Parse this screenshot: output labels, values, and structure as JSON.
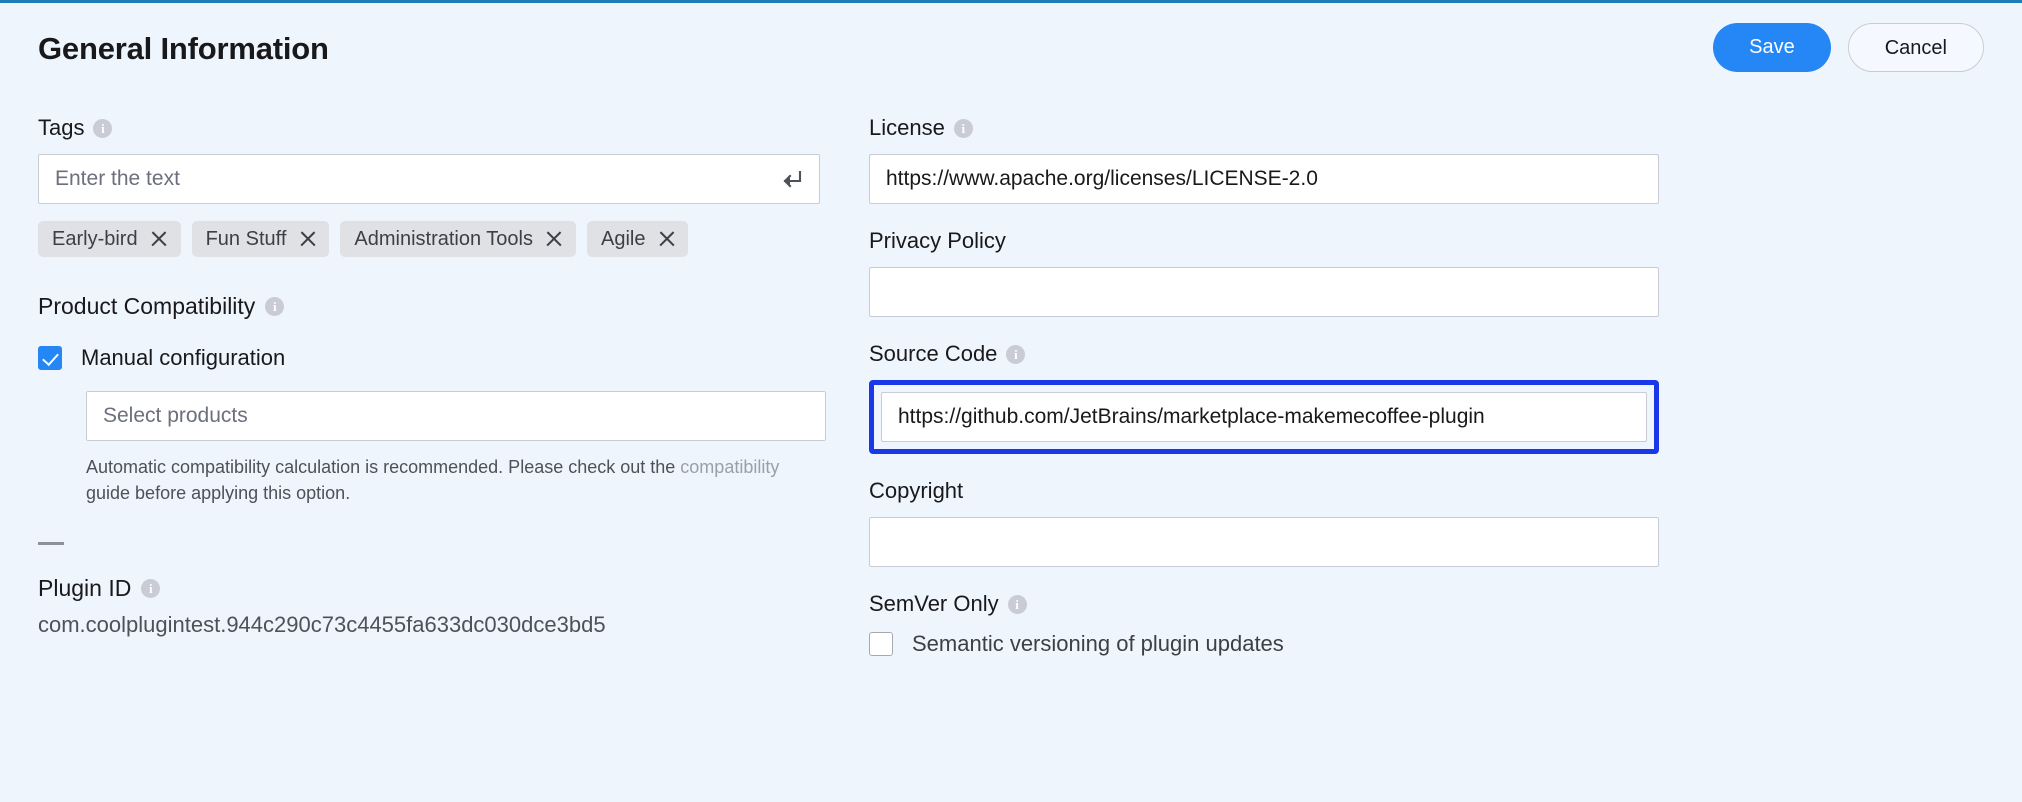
{
  "theme": {
    "background": "#eff5fd",
    "accent": "#2587f5",
    "top_rule": "#1a7fb8",
    "focus_ring": "#1a37e8",
    "chip_bg": "#dfe1e5"
  },
  "header": {
    "title": "General Information",
    "save_label": "Save",
    "cancel_label": "Cancel"
  },
  "left": {
    "tags": {
      "label": "Tags",
      "info_icon": "info-icon",
      "placeholder": "Enter the text",
      "value": "",
      "enter_icon": "enter-return-icon",
      "chips": [
        {
          "label": "Early-bird",
          "remove_icon": "close-icon"
        },
        {
          "label": "Fun Stuff",
          "remove_icon": "close-icon"
        },
        {
          "label": "Administration Tools",
          "remove_icon": "close-icon"
        },
        {
          "label": "Agile",
          "remove_icon": "close-icon"
        }
      ]
    },
    "product_compatibility": {
      "label": "Product Compatibility",
      "info_icon": "info-icon",
      "manual_checkbox": {
        "label": "Manual configuration",
        "checked": true
      },
      "select_products": {
        "placeholder": "Select products",
        "value": ""
      },
      "helper_prefix": "Automatic compatibility calculation is recommended. Please check out the ",
      "helper_link": "compatibility",
      "helper_suffix": " guide before applying this option."
    },
    "plugin_id": {
      "label": "Plugin ID",
      "info_icon": "info-icon",
      "value": "com.coolplugintest.944c290c73c4455fa633dc030dce3bd5"
    }
  },
  "right": {
    "license": {
      "label": "License",
      "info_icon": "info-icon",
      "value": "https://www.apache.org/licenses/LICENSE-2.0",
      "placeholder": ""
    },
    "privacy_policy": {
      "label": "Privacy Policy",
      "value": "",
      "placeholder": ""
    },
    "source_code": {
      "label": "Source Code",
      "info_icon": "info-icon",
      "value": "https://github.com/JetBrains/marketplace-makemecoffee-plugin",
      "placeholder": "",
      "focused": true
    },
    "copyright": {
      "label": "Copyright",
      "value": "",
      "placeholder": ""
    },
    "semver": {
      "label": "SemVer Only",
      "info_icon": "info-icon",
      "checkbox": {
        "label": "Semantic versioning of plugin updates",
        "checked": false
      }
    }
  }
}
